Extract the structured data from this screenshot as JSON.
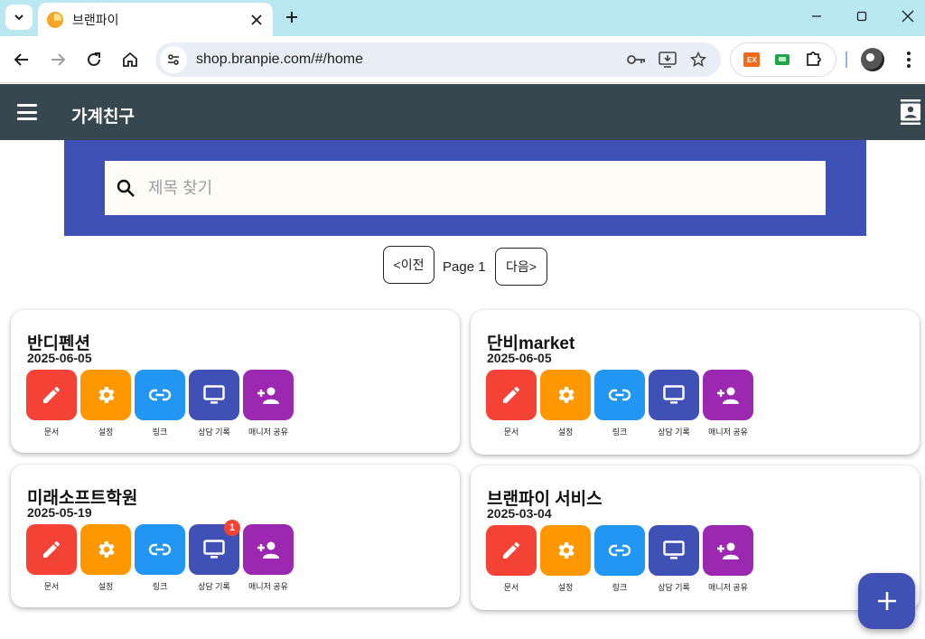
{
  "browser": {
    "tab_title": "브랜파이",
    "url": "shop.branpie.com/#/home",
    "ext_label": "EX"
  },
  "app": {
    "title": "가계친구",
    "search_placeholder": "제목 찾기"
  },
  "pager": {
    "prev_label": "<이전",
    "page_label": "Page 1",
    "next_label": "다음>"
  },
  "cards": [
    {
      "title": "반디펜션",
      "date": "2025-06-05",
      "badge": ""
    },
    {
      "title": "단비market",
      "date": "2025-06-05",
      "badge": ""
    },
    {
      "title": "미래소프트학원",
      "date": "2025-05-19",
      "badge": "1"
    },
    {
      "title": "브랜파이 서비스",
      "date": "2025-03-04",
      "badge": ""
    }
  ],
  "actions": [
    {
      "label": "문서",
      "icon": "edit-icon",
      "color": "#f44336"
    },
    {
      "label": "설정",
      "icon": "gear-icon",
      "color": "#ff9800"
    },
    {
      "label": "링크",
      "icon": "link-icon",
      "color": "#2196f3"
    },
    {
      "label": "상담 기록",
      "icon": "monitor-icon",
      "color": "#3f51b5"
    },
    {
      "label": "매니저 공유",
      "icon": "person-add-icon",
      "color": "#9c27b0"
    }
  ],
  "colors": {
    "appbar": "#37474f",
    "search_band": "#3f51b5",
    "fab": "#3f51b5",
    "badge": "#f44336"
  }
}
